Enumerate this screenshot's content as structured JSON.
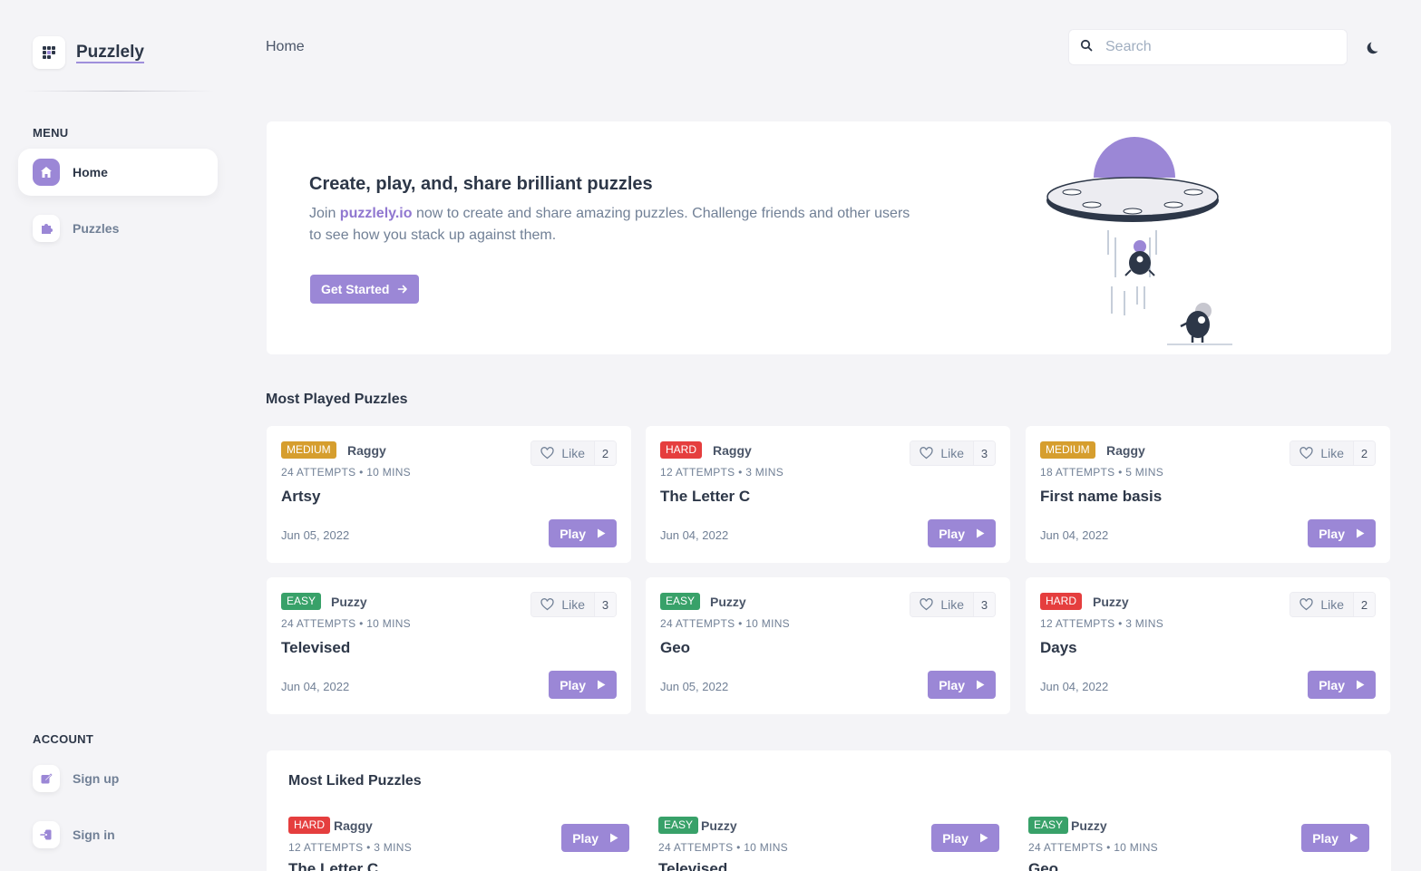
{
  "app": {
    "name": "Puzzlely"
  },
  "sidebar": {
    "menu_heading": "MENU",
    "menu": [
      {
        "label": "Home",
        "icon": "home-icon",
        "active": true
      },
      {
        "label": "Puzzles",
        "icon": "puzzle-icon",
        "active": false
      }
    ],
    "account_heading": "ACCOUNT",
    "account": [
      {
        "label": "Sign up",
        "icon": "edit-icon"
      },
      {
        "label": "Sign in",
        "icon": "sign-in-icon"
      }
    ]
  },
  "header": {
    "breadcrumb": "Home",
    "search_placeholder": "Search"
  },
  "hero": {
    "title": "Create, play, and, share brilliant puzzles",
    "text_prefix": "Join ",
    "brand_link": "puzzlely.io",
    "text_suffix": " now to create and share amazing puzzles. Challenge friends and other users to see how you stack up against them.",
    "cta": "Get Started"
  },
  "most_played": {
    "title": "Most Played Puzzles",
    "like_label": "Like",
    "play_label": "Play",
    "cards": [
      {
        "difficulty": "MEDIUM",
        "author": "Raggy",
        "meta": "24 ATTEMPTS • 10 MINS",
        "title": "Artsy",
        "date": "Jun 05, 2022",
        "likes": "2"
      },
      {
        "difficulty": "HARD",
        "author": "Raggy",
        "meta": "12 ATTEMPTS • 3 MINS",
        "title": "The Letter C",
        "date": "Jun 04, 2022",
        "likes": "3"
      },
      {
        "difficulty": "MEDIUM",
        "author": "Raggy",
        "meta": "18 ATTEMPTS • 5 MINS",
        "title": "First name basis",
        "date": "Jun 04, 2022",
        "likes": "2"
      },
      {
        "difficulty": "EASY",
        "author": "Puzzy",
        "meta": "24 ATTEMPTS • 10 MINS",
        "title": "Televised",
        "date": "Jun 04, 2022",
        "likes": "3"
      },
      {
        "difficulty": "EASY",
        "author": "Puzzy",
        "meta": "24 ATTEMPTS • 10 MINS",
        "title": "Geo",
        "date": "Jun 05, 2022",
        "likes": "3"
      },
      {
        "difficulty": "HARD",
        "author": "Puzzy",
        "meta": "12 ATTEMPTS • 3 MINS",
        "title": "Days",
        "date": "Jun 04, 2022",
        "likes": "2"
      }
    ]
  },
  "most_liked": {
    "title": "Most Liked Puzzles",
    "play_label": "Play",
    "items": [
      {
        "difficulty": "HARD",
        "author": "Raggy",
        "meta": "12 ATTEMPTS • 3 MINS",
        "title": "The Letter C"
      },
      {
        "difficulty": "EASY",
        "author": "Puzzy",
        "meta": "24 ATTEMPTS • 10 MINS",
        "title": "Televised"
      },
      {
        "difficulty": "EASY",
        "author": "Puzzy",
        "meta": "24 ATTEMPTS • 10 MINS",
        "title": "Geo"
      }
    ]
  },
  "colors": {
    "accent": "#9b87d6",
    "medium": "#d69e2e",
    "hard": "#e53e3e",
    "easy": "#38a169"
  }
}
